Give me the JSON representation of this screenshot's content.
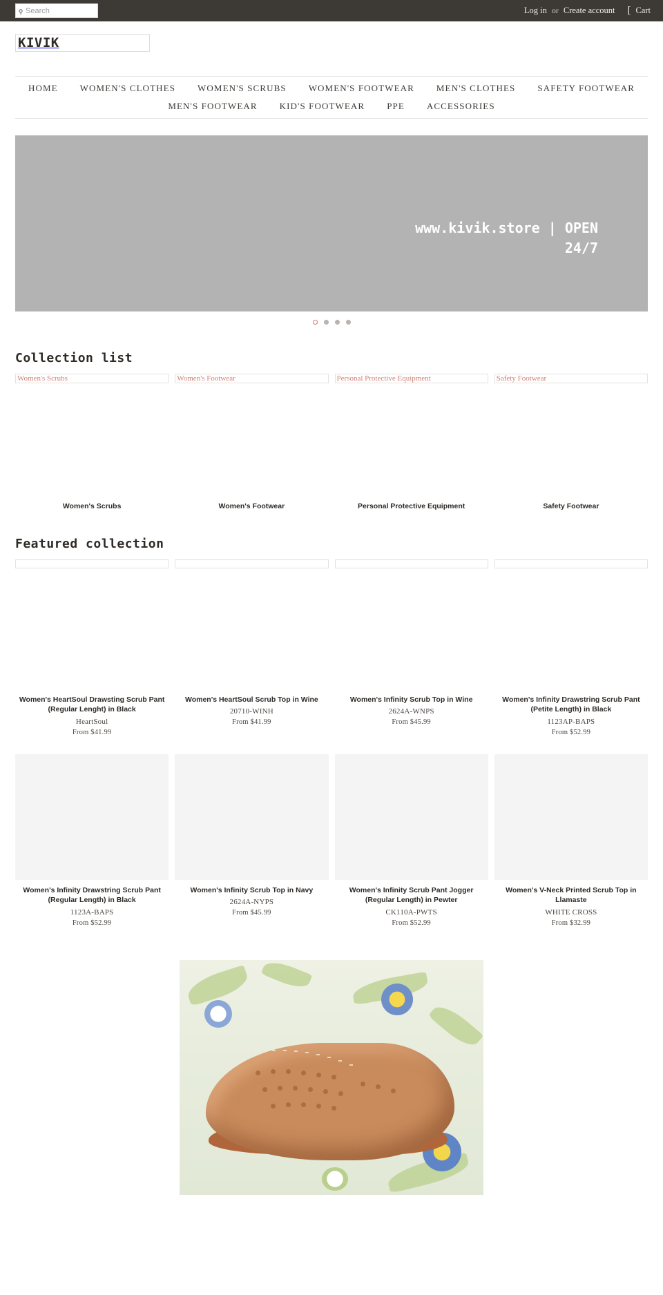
{
  "topbar": {
    "search_placeholder": "Search",
    "search_value": "",
    "search_icon": "search-icon",
    "login_label": "Log in",
    "or_label": "or",
    "create_account_label": "Create account",
    "cart_label": "Cart",
    "cart_icon": "shopping-cart-icon",
    "background_color": "#3d3935"
  },
  "header": {
    "logo_text": "KIVIK"
  },
  "nav": {
    "row1": [
      {
        "label": "HOME"
      },
      {
        "label": "WOMEN'S CLOTHES"
      },
      {
        "label": "WOMEN'S SCRUBS"
      },
      {
        "label": "WOMEN'S FOOTWEAR"
      },
      {
        "label": "MEN'S CLOTHES"
      },
      {
        "label": "SAFETY FOOTWEAR"
      }
    ],
    "row2": [
      {
        "label": "MEN'S FOOTWEAR"
      },
      {
        "label": "KID'S FOOTWEAR"
      },
      {
        "label": "PPE"
      },
      {
        "label": "ACCESSORIES"
      }
    ]
  },
  "slideshow": {
    "line1": "www.kivik.store | OPEN",
    "line2": "24/7",
    "background_color": "#b3b3b3",
    "dots": [
      {
        "active": true
      },
      {
        "active": false
      },
      {
        "active": false
      },
      {
        "active": false
      }
    ]
  },
  "collection_list": {
    "title": "Collection list",
    "items": [
      {
        "alt_text": "Women's Scrubs",
        "caption": "Women's Scrubs"
      },
      {
        "alt_text": "Women's Footwear",
        "caption": "Women's Footwear"
      },
      {
        "alt_text": "Personal Protective Equipment",
        "caption": "Personal Protective Equipment"
      },
      {
        "alt_text": "Safety Footwear",
        "caption": "Safety Footwear"
      }
    ],
    "link_color": "#cf8178"
  },
  "featured_collection": {
    "title": "Featured collection",
    "row1": [
      {
        "title": "Women's HeartSoul Drawsting Scrub Pant (Regular Lenght) in Black",
        "vendor": "HeartSoul",
        "price": "From  $41.99"
      },
      {
        "title": "Women's HeartSoul Scrub Top in Wine",
        "vendor": "20710-WINH",
        "price": "From  $41.99"
      },
      {
        "title": "Women's Infinity Scrub Top in Wine",
        "vendor": "2624A-WNPS",
        "price": "From  $45.99"
      },
      {
        "title": "Women's Infinity Drawstring Scrub Pant (Petite Length) in Black",
        "vendor": "1123AP-BAPS",
        "price": "From  $52.99"
      }
    ],
    "row2": [
      {
        "title": "Women's Infinity Drawstring Scrub Pant (Regular Length) in Black",
        "vendor": "1123A-BAPS",
        "price": "From  $52.99"
      },
      {
        "title": "Women's Infinity Scrub Top in Navy",
        "vendor": "2624A-NYPS",
        "price": "From  $45.99"
      },
      {
        "title": "Women's Infinity Scrub Pant Jogger (Regular Length) in Pewter",
        "vendor": "CK110A-PWTS",
        "price": "From  $52.99"
      },
      {
        "title": "Women's V-Neck Printed Scrub Top in Llamaste",
        "vendor": "WHITE CROSS",
        "price": "From  $32.99"
      }
    ]
  },
  "promo": {
    "image_name": "tan-perforated-leather-loafer-on-floral-fabric"
  }
}
